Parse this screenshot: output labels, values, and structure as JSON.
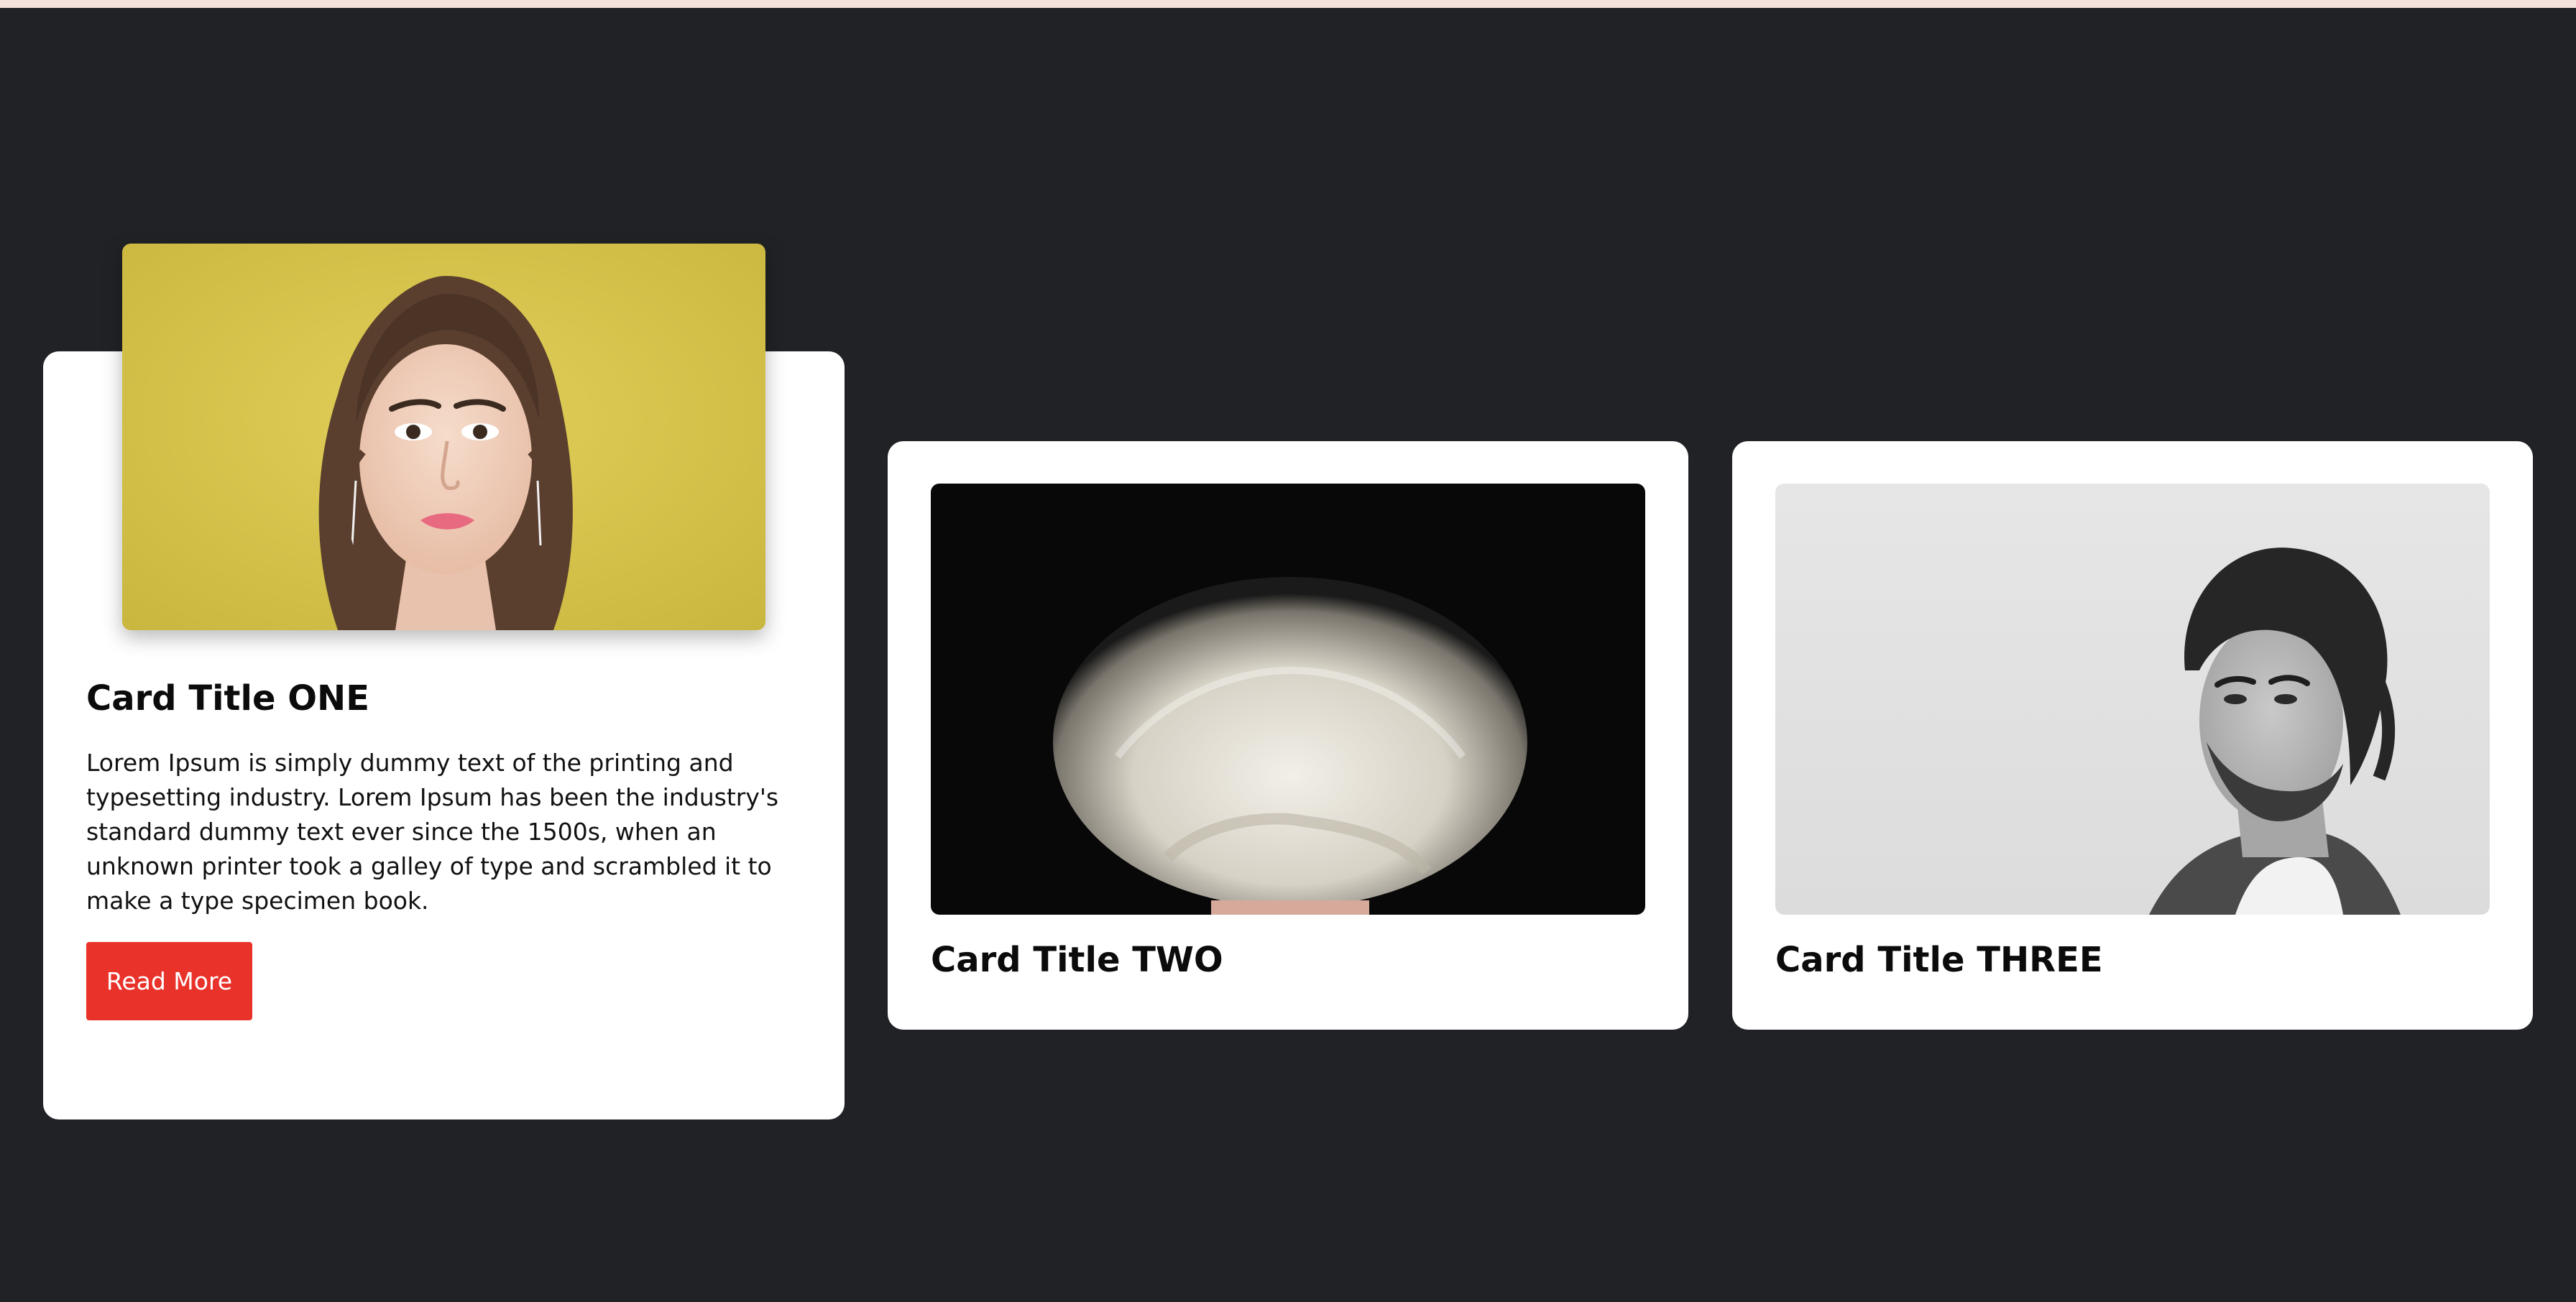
{
  "cards": [
    {
      "title": "Card Title ONE",
      "text": "Lorem Ipsum is simply dummy text of the printing and typesetting industry. Lorem Ipsum has been the industry's standard dummy text ever since the 1500s, when an unknown printer took a galley of type and scrambled it to make a type specimen book.",
      "button_label": "Read More",
      "button_color": "#e8322a",
      "image_background": "#d9c84f"
    },
    {
      "title": "Card Title TWO",
      "image_background": "#0b0b0b"
    },
    {
      "title": "Card Title THREE",
      "image_background": "#e6e6e6"
    }
  ],
  "colors": {
    "page_background": "#212226",
    "card_background": "#ffffff",
    "top_strip": "#f4e3dd"
  }
}
